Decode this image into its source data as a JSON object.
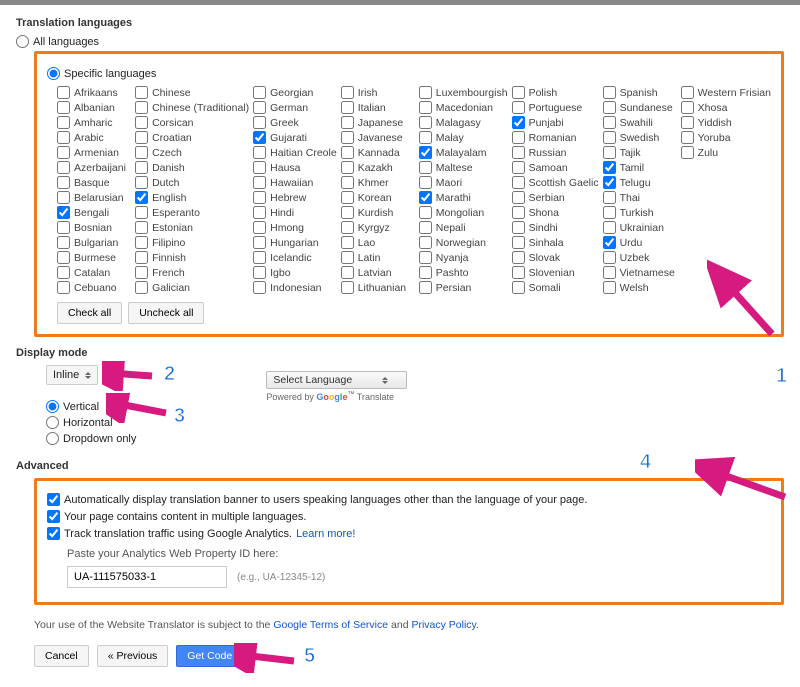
{
  "sections": {
    "translation_languages": "Translation languages",
    "display_mode": "Display mode",
    "advanced": "Advanced"
  },
  "lang_radio": {
    "all": "All languages",
    "specific": "Specific languages"
  },
  "selected_specific": true,
  "languages": [
    {
      "label": "Afrikaans",
      "c": false
    },
    {
      "label": "Chinese",
      "c": false
    },
    {
      "label": "Georgian",
      "c": false
    },
    {
      "label": "Irish",
      "c": false
    },
    {
      "label": "Luxembourgish",
      "c": false
    },
    {
      "label": "Polish",
      "c": false
    },
    {
      "label": "Spanish",
      "c": false
    },
    {
      "label": "Western Frisian",
      "c": false
    },
    {
      "label": "Albanian",
      "c": false
    },
    {
      "label": "Chinese (Traditional)",
      "c": false
    },
    {
      "label": "German",
      "c": false
    },
    {
      "label": "Italian",
      "c": false
    },
    {
      "label": "Macedonian",
      "c": false
    },
    {
      "label": "Portuguese",
      "c": false
    },
    {
      "label": "Sundanese",
      "c": false
    },
    {
      "label": "Xhosa",
      "c": false
    },
    {
      "label": "Amharic",
      "c": false
    },
    {
      "label": "Corsican",
      "c": false
    },
    {
      "label": "Greek",
      "c": false
    },
    {
      "label": "Japanese",
      "c": false
    },
    {
      "label": "Malagasy",
      "c": false
    },
    {
      "label": "Punjabi",
      "c": true
    },
    {
      "label": "Swahili",
      "c": false
    },
    {
      "label": "Yiddish",
      "c": false
    },
    {
      "label": "Arabic",
      "c": false
    },
    {
      "label": "Croatian",
      "c": false
    },
    {
      "label": "Gujarati",
      "c": true
    },
    {
      "label": "Javanese",
      "c": false
    },
    {
      "label": "Malay",
      "c": false
    },
    {
      "label": "Romanian",
      "c": false
    },
    {
      "label": "Swedish",
      "c": false
    },
    {
      "label": "Yoruba",
      "c": false
    },
    {
      "label": "Armenian",
      "c": false
    },
    {
      "label": "Czech",
      "c": false
    },
    {
      "label": "Haitian Creole",
      "c": false
    },
    {
      "label": "Kannada",
      "c": false
    },
    {
      "label": "Malayalam",
      "c": true
    },
    {
      "label": "Russian",
      "c": false
    },
    {
      "label": "Tajik",
      "c": false
    },
    {
      "label": "Zulu",
      "c": false
    },
    {
      "label": "Azerbaijani",
      "c": false
    },
    {
      "label": "Danish",
      "c": false
    },
    {
      "label": "Hausa",
      "c": false
    },
    {
      "label": "Kazakh",
      "c": false
    },
    {
      "label": "Maltese",
      "c": false
    },
    {
      "label": "Samoan",
      "c": false
    },
    {
      "label": "Tamil",
      "c": true
    },
    {
      "label": "",
      "c": false
    },
    {
      "label": "Basque",
      "c": false
    },
    {
      "label": "Dutch",
      "c": false
    },
    {
      "label": "Hawaiian",
      "c": false
    },
    {
      "label": "Khmer",
      "c": false
    },
    {
      "label": "Maori",
      "c": false
    },
    {
      "label": "Scottish Gaelic",
      "c": false
    },
    {
      "label": "Telugu",
      "c": true
    },
    {
      "label": "",
      "c": false
    },
    {
      "label": "Belarusian",
      "c": false
    },
    {
      "label": "English",
      "c": true
    },
    {
      "label": "Hebrew",
      "c": false
    },
    {
      "label": "Korean",
      "c": false
    },
    {
      "label": "Marathi",
      "c": true
    },
    {
      "label": "Serbian",
      "c": false
    },
    {
      "label": "Thai",
      "c": false
    },
    {
      "label": "",
      "c": false
    },
    {
      "label": "Bengali",
      "c": true
    },
    {
      "label": "Esperanto",
      "c": false
    },
    {
      "label": "Hindi",
      "c": false
    },
    {
      "label": "Kurdish",
      "c": false
    },
    {
      "label": "Mongolian",
      "c": false
    },
    {
      "label": "Shona",
      "c": false
    },
    {
      "label": "Turkish",
      "c": false
    },
    {
      "label": "",
      "c": false
    },
    {
      "label": "Bosnian",
      "c": false
    },
    {
      "label": "Estonian",
      "c": false
    },
    {
      "label": "Hmong",
      "c": false
    },
    {
      "label": "Kyrgyz",
      "c": false
    },
    {
      "label": "Nepali",
      "c": false
    },
    {
      "label": "Sindhi",
      "c": false
    },
    {
      "label": "Ukrainian",
      "c": false
    },
    {
      "label": "",
      "c": false
    },
    {
      "label": "Bulgarian",
      "c": false
    },
    {
      "label": "Filipino",
      "c": false
    },
    {
      "label": "Hungarian",
      "c": false
    },
    {
      "label": "Lao",
      "c": false
    },
    {
      "label": "Norwegian",
      "c": false
    },
    {
      "label": "Sinhala",
      "c": false
    },
    {
      "label": "Urdu",
      "c": true
    },
    {
      "label": "",
      "c": false
    },
    {
      "label": "Burmese",
      "c": false
    },
    {
      "label": "Finnish",
      "c": false
    },
    {
      "label": "Icelandic",
      "c": false
    },
    {
      "label": "Latin",
      "c": false
    },
    {
      "label": "Nyanja",
      "c": false
    },
    {
      "label": "Slovak",
      "c": false
    },
    {
      "label": "Uzbek",
      "c": false
    },
    {
      "label": "",
      "c": false
    },
    {
      "label": "Catalan",
      "c": false
    },
    {
      "label": "French",
      "c": false
    },
    {
      "label": "Igbo",
      "c": false
    },
    {
      "label": "Latvian",
      "c": false
    },
    {
      "label": "Pashto",
      "c": false
    },
    {
      "label": "Slovenian",
      "c": false
    },
    {
      "label": "Vietnamese",
      "c": false
    },
    {
      "label": "",
      "c": false
    },
    {
      "label": "Cebuano",
      "c": false
    },
    {
      "label": "Galician",
      "c": false
    },
    {
      "label": "Indonesian",
      "c": false
    },
    {
      "label": "Lithuanian",
      "c": false
    },
    {
      "label": "Persian",
      "c": false
    },
    {
      "label": "Somali",
      "c": false
    },
    {
      "label": "Welsh",
      "c": false
    },
    {
      "label": "",
      "c": false
    }
  ],
  "buttons": {
    "check_all": "Check all",
    "uncheck_all": "Uncheck all",
    "cancel": "Cancel",
    "previous": "« Previous",
    "getcode": "Get Code »"
  },
  "display": {
    "select_value": "Inline",
    "opt_vertical": "Vertical",
    "opt_horizontal": "Horizontal",
    "opt_dropdown": "Dropdown only",
    "preview_select": "Select Language",
    "powered": "Powered by ",
    "translate": " Translate"
  },
  "advanced": {
    "cb1": "Automatically display translation banner to users speaking languages other than the language of your page.",
    "cb2": "Your page contains content in multiple languages.",
    "cb3_a": "Track translation traffic using Google Analytics. ",
    "cb3_link": "Learn more!",
    "paste_label": "Paste your Analytics Web Property ID here:",
    "ua_value": "UA-111575033-1",
    "ua_hint": "(e.g., UA-12345-12)"
  },
  "footer": {
    "pre": "Your use of the Website Translator is subject to the ",
    "tos": "Google Terms of Service",
    "and": " and ",
    "pp": "Privacy Policy",
    "dot": "."
  },
  "annotations": {
    "a1": "1",
    "a2": "2",
    "a3": "3",
    "a4": "4",
    "a5": "5"
  }
}
